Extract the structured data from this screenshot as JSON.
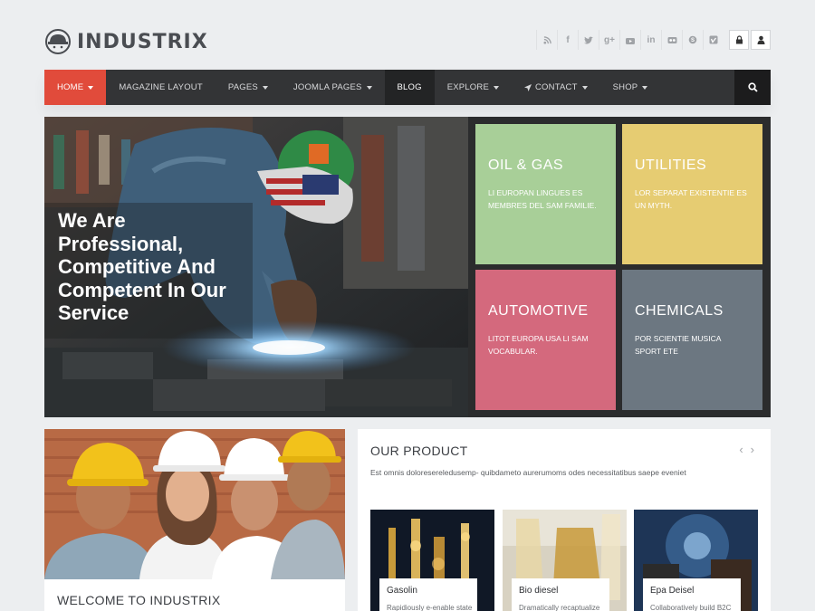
{
  "brand": {
    "name": "INDUSTRIX"
  },
  "social": {
    "icons": [
      "rss-icon",
      "facebook-icon",
      "twitter-icon",
      "google-plus-icon",
      "youtube-icon",
      "linkedin-icon",
      "flickr-icon",
      "skype-icon",
      "vimeo-icon"
    ]
  },
  "nav": {
    "items": [
      {
        "label": "HOME",
        "caret": true
      },
      {
        "label": "MAGAZINE LAYOUT",
        "caret": false
      },
      {
        "label": "PAGES",
        "caret": true
      },
      {
        "label": "JOOMLA PAGES",
        "caret": true
      },
      {
        "label": "BLOG",
        "caret": false
      },
      {
        "label": "EXPLORE",
        "caret": true
      },
      {
        "label": "CONTACT",
        "caret": true
      },
      {
        "label": "SHOP",
        "caret": true
      }
    ]
  },
  "hero": {
    "title": "We Are Professional, Competitive And Competent In Our Service",
    "tiles": [
      {
        "title": "OIL & GAS",
        "desc": "LI EUROPAN LINGUES ES MEMBRES DEL SAM FAMILIE.",
        "color": "#a8cf98"
      },
      {
        "title": "UTILITIES",
        "desc": "LOR SEPARAT EXISTENTIE ES UN MYTH.",
        "color": "#e6cc72"
      },
      {
        "title": "AUTOMOTIVE",
        "desc": "LITOT EUROPA USA LI SAM VOCABULAR.",
        "color": "#d4697d"
      },
      {
        "title": "CHEMICALS",
        "desc": "POR SCIENTIE MUSICA SPORT ETE",
        "color": "#6c7781"
      }
    ]
  },
  "welcome": {
    "title": "WELCOME TO INDUSTRIX"
  },
  "product": {
    "title": "OUR PRODUCT",
    "desc": "Est omnis doloresereledusemp- quibdameto aurerumoms odes necessitatibus saepe eveniet",
    "items": [
      {
        "name": "Gasolin",
        "desc": "Rapidiously e-enable state"
      },
      {
        "name": "Bio diesel",
        "desc": "Dramatically recaptualize"
      },
      {
        "name": "Epa Deisel",
        "desc": "Collaboratively build B2C"
      }
    ]
  },
  "colors": {
    "accent": "#e14b3b",
    "nav_bg": "#333436",
    "page_bg": "#eceef0"
  }
}
